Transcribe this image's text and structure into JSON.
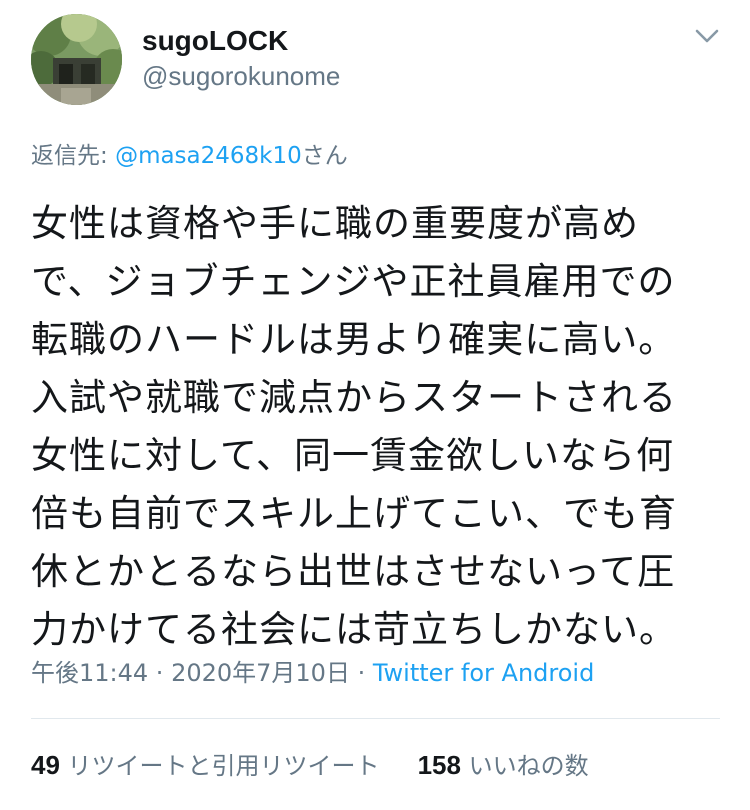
{
  "user": {
    "display_name": "sugoLOCK",
    "handle": "@sugorokunome",
    "avatar": "avatar"
  },
  "menu_icon": "chevron-down-icon",
  "reply": {
    "prefix": "返信先: ",
    "mention": "@masa2468k10",
    "suffix": "さん"
  },
  "tweet": {
    "lines": [
      "女性は資格や手に職の重要度が高め",
      "で、ジョブチェンジや正社員雇用での",
      "転職のハードルは男より確実に高い。",
      "入試や就職で減点からスタートされる",
      "女性に対して、同一賃金欲しいなら何",
      "倍も自前でスキル上げてこい、でも育",
      "休とかとるなら出世はさせないって圧",
      "力かけてる社会には苛立ちしかない。"
    ]
  },
  "meta": {
    "time": "午後11:44",
    "sep1": " · ",
    "date": "2020年7月10日",
    "sep2": " · ",
    "source": "Twitter for Android"
  },
  "stats": {
    "retweets_count": "49",
    "retweets_label": " リツイートと引用リツイート",
    "likes_count": "158",
    "likes_label": " いいねの数"
  },
  "colors": {
    "text": "#14171a",
    "muted": "#657786",
    "link": "#1da1f2",
    "divider": "#e1e8ed"
  }
}
